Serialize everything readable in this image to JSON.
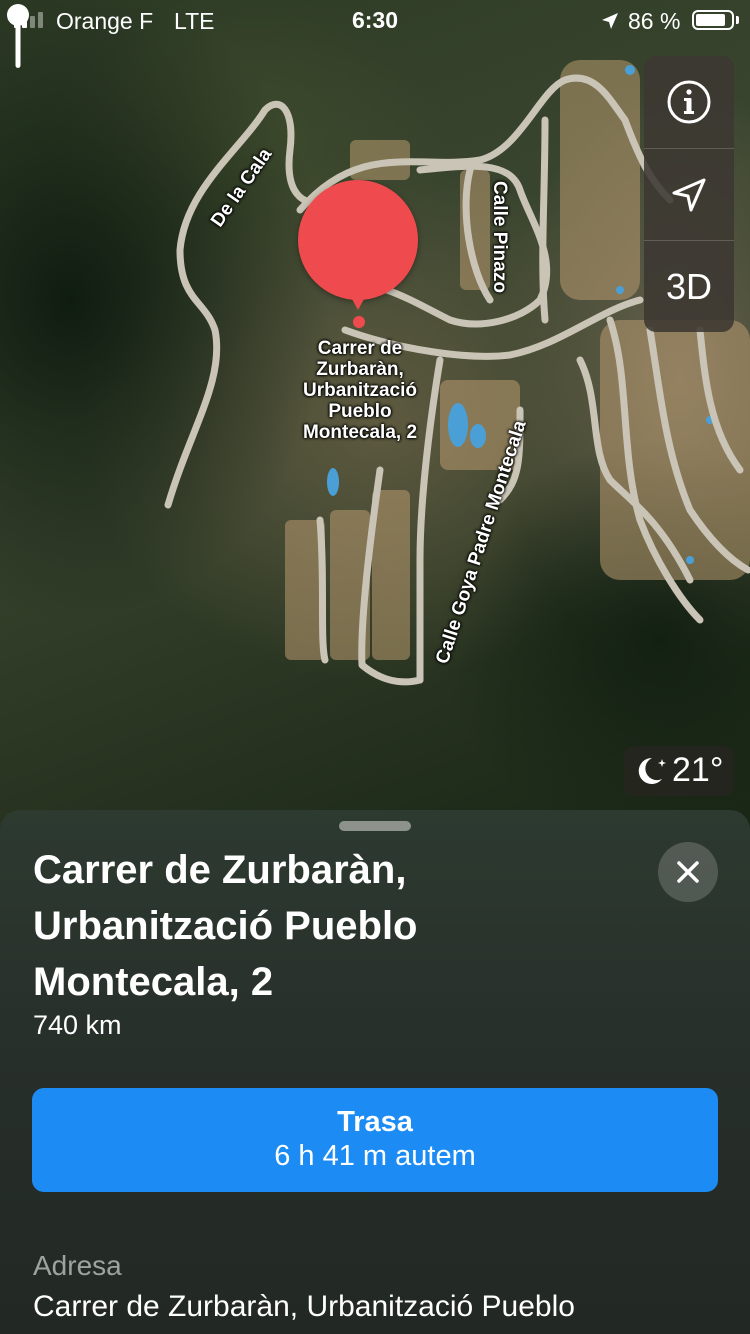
{
  "status_bar": {
    "carrier": "Orange F",
    "network": "LTE",
    "time": "6:30",
    "battery_percent": "86 %",
    "battery_level": 0.86,
    "signal_bars": 2
  },
  "map": {
    "road_labels": [
      "De la Cala",
      "Calle Pinazo",
      "Calle Goya Padre Montecala"
    ],
    "place_label_lines": [
      "Carrer de",
      "Zurbaràn,",
      "Urbanització",
      "Pueblo",
      "Montecala, 2"
    ],
    "pin_color": "#ef4b4f"
  },
  "controls": {
    "info_icon": "info-icon",
    "location_icon": "location-arrow-icon",
    "view_mode_label": "3D"
  },
  "weather": {
    "icon": "moon-icon",
    "temperature": "21°"
  },
  "place_card": {
    "title_lines": [
      "Carrer de Zurbaràn,",
      "Urbanització Pueblo",
      "Montecala, 2"
    ],
    "distance": "740 km",
    "route_button": {
      "label": "Trasa",
      "subtitle": "6 h 41 m autem",
      "color": "#1c8cf4"
    },
    "address_label": "Adresa",
    "address_value": "Carrer de Zurbaràn, Urbanització Pueblo"
  }
}
